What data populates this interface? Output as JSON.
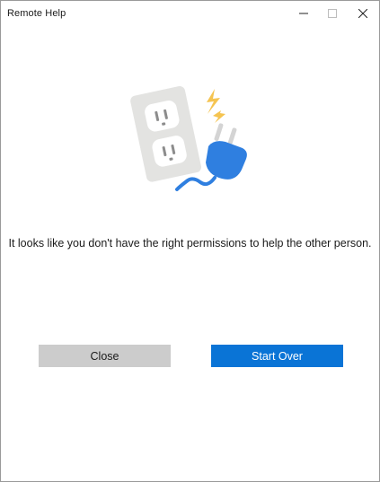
{
  "window": {
    "title": "Remote Help",
    "controls": [
      "minimize",
      "maximize",
      "close"
    ]
  },
  "illustration": {
    "icons": [
      "power-outlet-icon",
      "plug-icon",
      "spark-icon"
    ],
    "colors": {
      "outlet": "#e3e3e1",
      "socket": "#ffffff",
      "plug": "#2f7fe0",
      "cable": "#2f7fe0",
      "spark": "#f5c451"
    }
  },
  "main": {
    "message": "It looks like you don't have the right permissions to help the other person."
  },
  "actions": {
    "close_label": "Close",
    "start_over_label": "Start Over"
  },
  "colors": {
    "primary_button": "#0a74d6",
    "secondary_button": "#cccccc"
  }
}
